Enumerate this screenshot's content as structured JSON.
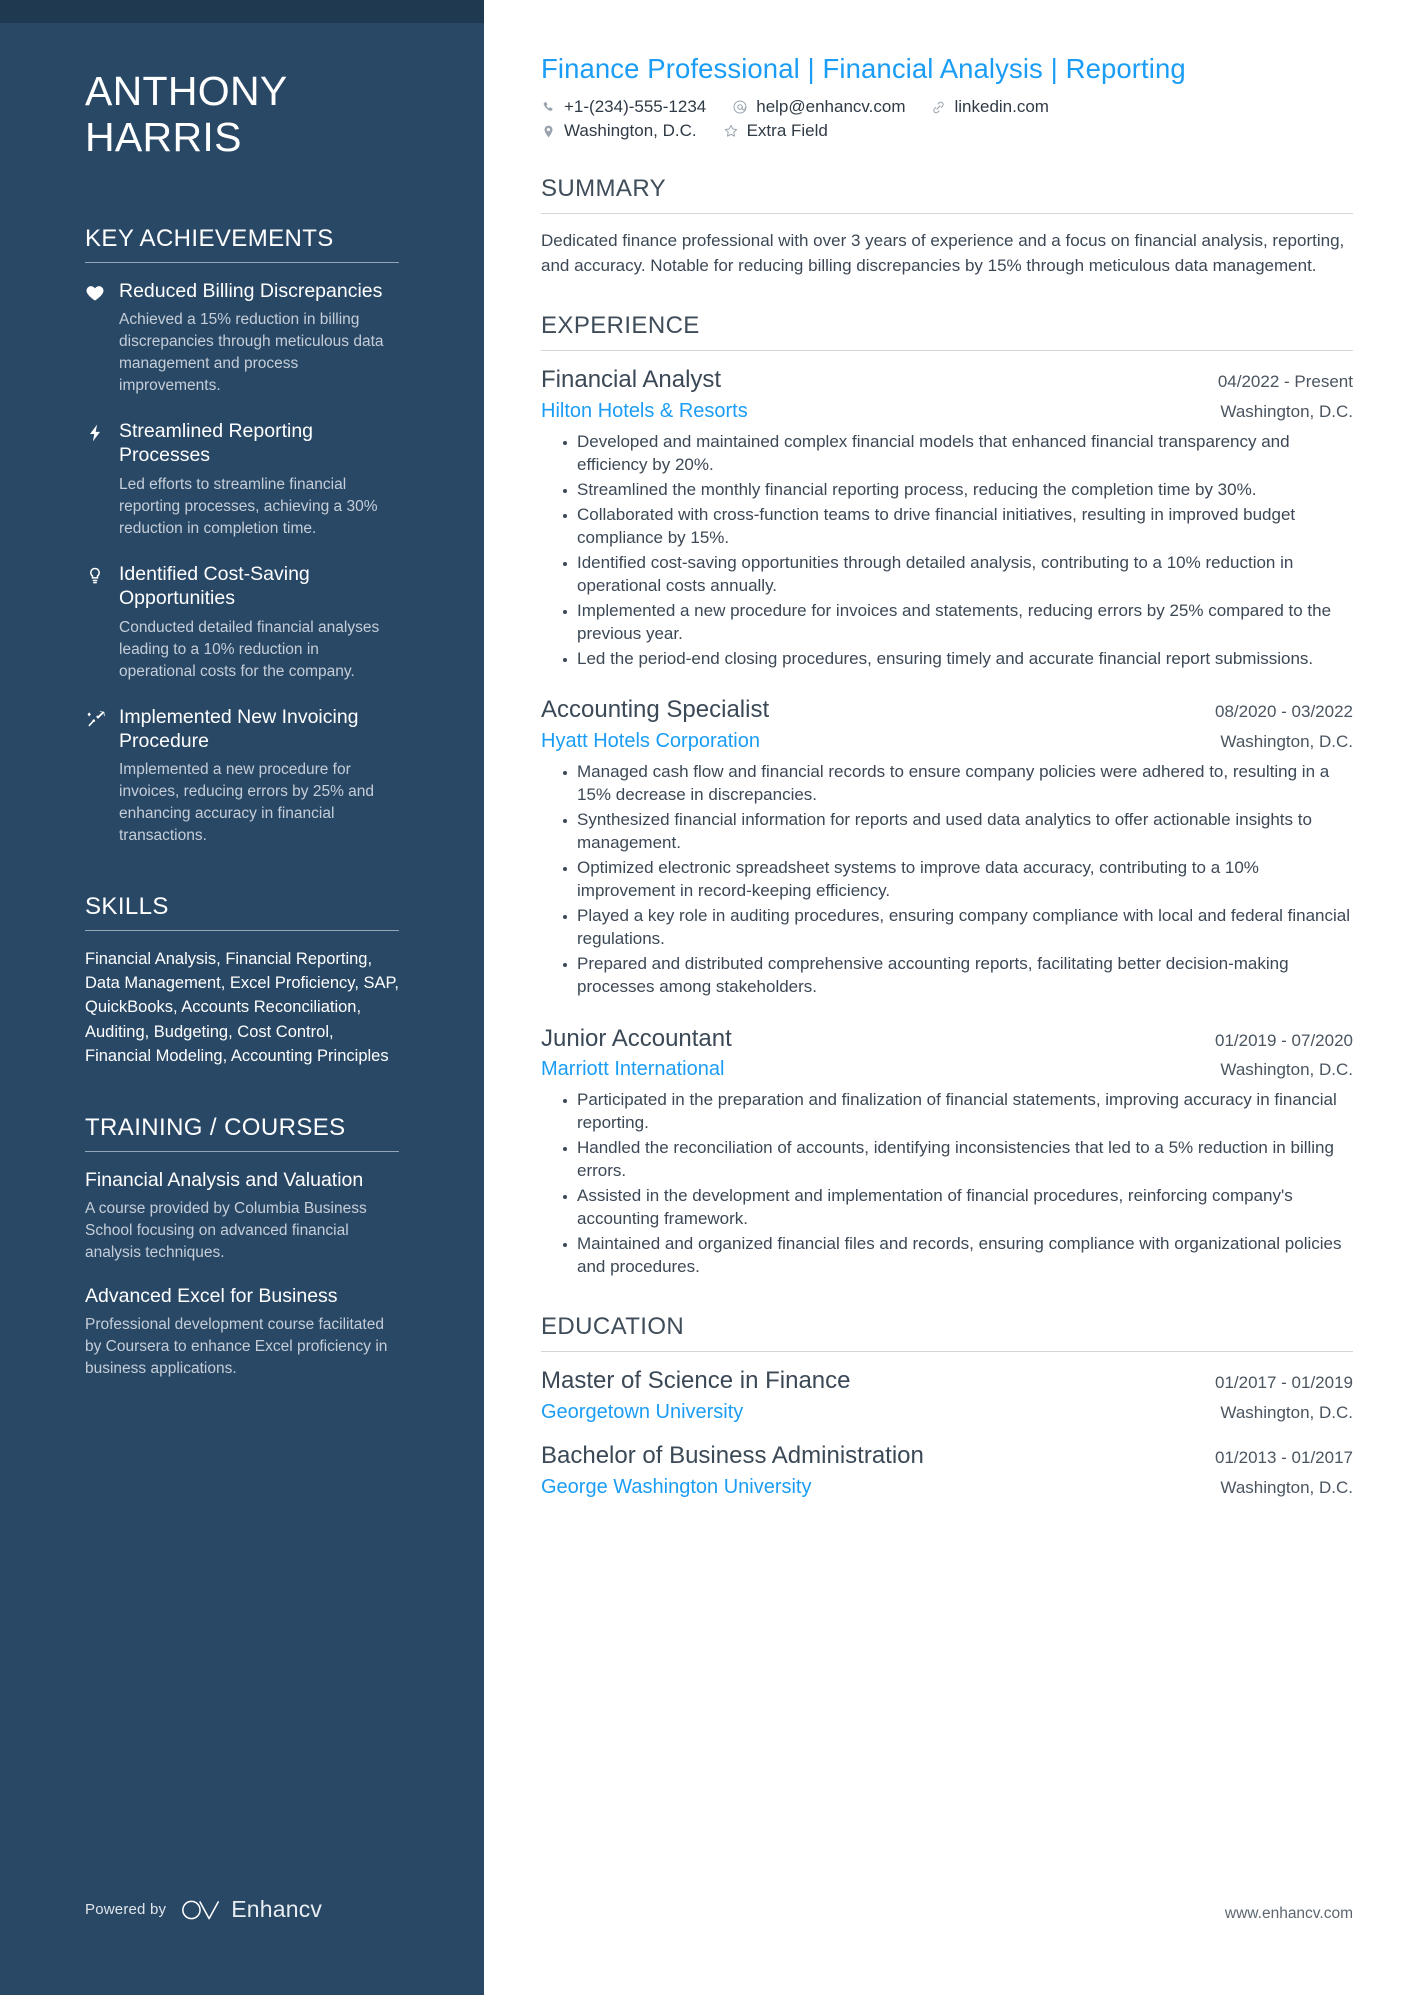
{
  "sidebar": {
    "name_lines": [
      "ANTHONY",
      "HARRIS"
    ],
    "achievements_heading": "KEY ACHIEVEMENTS",
    "achievements": [
      {
        "icon": "heart-icon",
        "title": "Reduced Billing Discrepancies",
        "desc": "Achieved a 15% reduction in billing discrepancies through meticulous data management and process improvements."
      },
      {
        "icon": "lightning-bolt-icon",
        "title": "Streamlined Reporting Processes",
        "desc": "Led efforts to streamline financial reporting processes, achieving a 30% reduction in completion time."
      },
      {
        "icon": "lightbulb-icon",
        "title": "Identified Cost-Saving Opportunities",
        "desc": "Conducted detailed financial analyses leading to a 10% reduction in operational costs for the company."
      },
      {
        "icon": "trend-arrow-icon",
        "title": "Implemented New Invoicing Procedure",
        "desc": "Implemented a new procedure for invoices, reducing errors by 25% and enhancing accuracy in financial transactions."
      }
    ],
    "skills_heading": "SKILLS",
    "skills_text": "Financial Analysis, Financial Reporting, Data Management, Excel Proficiency, SAP, QuickBooks, Accounts Reconciliation, Auditing, Budgeting, Cost Control, Financial Modeling, Accounting Principles",
    "training_heading": "TRAINING / COURSES",
    "courses": [
      {
        "title": "Financial Analysis and Valuation",
        "desc": "A course provided by Columbia Business School focusing on advanced financial analysis techniques."
      },
      {
        "title": "Advanced Excel for Business",
        "desc": "Professional development course facilitated by Coursera to enhance Excel proficiency in business applications."
      }
    ],
    "powered_by_label": "Powered by",
    "powered_by_name": "Enhancv"
  },
  "header": {
    "headline": "Finance Professional | Financial Analysis | Reporting",
    "contacts_row1": [
      {
        "icon": "phone-icon",
        "text": "+1-(234)-555-1234"
      },
      {
        "icon": "email-at-icon",
        "text": "help@enhancv.com"
      },
      {
        "icon": "link-icon",
        "text": "linkedin.com"
      }
    ],
    "contacts_row2": [
      {
        "icon": "location-pin-icon",
        "text": "Washington, D.C."
      },
      {
        "icon": "star-icon",
        "text": "Extra Field"
      }
    ]
  },
  "summary": {
    "heading": "SUMMARY",
    "text": "Dedicated finance professional with over 3 years of experience and a focus on financial analysis, reporting, and accuracy. Notable for reducing billing discrepancies by 15% through meticulous data management."
  },
  "experience": {
    "heading": "EXPERIENCE",
    "entries": [
      {
        "title": "Financial Analyst",
        "date": "04/2022 - Present",
        "org": "Hilton Hotels & Resorts",
        "location": "Washington, D.C.",
        "bullets": [
          "Developed and maintained complex financial models that enhanced financial transparency and efficiency by 20%.",
          "Streamlined the monthly financial reporting process, reducing the completion time by 30%.",
          "Collaborated with cross-function teams to drive financial initiatives, resulting in improved budget compliance by 15%.",
          "Identified cost-saving opportunities through detailed analysis, contributing to a 10% reduction in operational costs annually.",
          "Implemented a new procedure for invoices and statements, reducing errors by 25% compared to the previous year.",
          "Led the period-end closing procedures, ensuring timely and accurate financial report submissions."
        ]
      },
      {
        "title": "Accounting Specialist",
        "date": "08/2020 - 03/2022",
        "org": "Hyatt Hotels Corporation",
        "location": "Washington, D.C.",
        "bullets": [
          "Managed cash flow and financial records to ensure company policies were adhered to, resulting in a 15% decrease in discrepancies.",
          "Synthesized financial information for reports and used data analytics to offer actionable insights to management.",
          "Optimized electronic spreadsheet systems to improve data accuracy, contributing to a 10% improvement in record-keeping efficiency.",
          "Played a key role in auditing procedures, ensuring company compliance with local and federal financial regulations.",
          "Prepared and distributed comprehensive accounting reports, facilitating better decision-making processes among stakeholders."
        ]
      },
      {
        "title": "Junior Accountant",
        "date": "01/2019 - 07/2020",
        "org": "Marriott International",
        "location": "Washington, D.C.",
        "bullets": [
          "Participated in the preparation and finalization of financial statements, improving accuracy in financial reporting.",
          "Handled the reconciliation of accounts, identifying inconsistencies that led to a 5% reduction in billing errors.",
          "Assisted in the development and implementation of financial procedures, reinforcing company's accounting framework.",
          "Maintained and organized financial files and records, ensuring compliance with organizational policies and procedures."
        ]
      }
    ]
  },
  "education": {
    "heading": "EDUCATION",
    "entries": [
      {
        "title": "Master of Science in Finance",
        "date": "01/2017 - 01/2019",
        "org": "Georgetown University",
        "location": "Washington, D.C."
      },
      {
        "title": "Bachelor of Business Administration",
        "date": "01/2013 - 01/2017",
        "org": "George Washington University",
        "location": "Washington, D.C."
      }
    ]
  },
  "footer": {
    "website": "www.enhancv.com"
  },
  "colors": {
    "sidebar_bg": "#294866",
    "sidebar_topbar": "#1e3950",
    "accent_blue": "#1b9df5",
    "body_text": "#3c4855"
  }
}
